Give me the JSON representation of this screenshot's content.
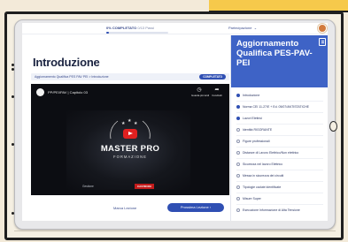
{
  "topbar": {
    "progress_label": "0% COMPLETATO",
    "progress_sub": "0/13 Passi",
    "progress_fraction": 0.0,
    "user_link": "Partecipazione"
  },
  "main": {
    "title": "Introduzione",
    "crumb": "Aggiornamento Qualifica PES PAV PEI > Introduzione",
    "badge": "COMPLETATO"
  },
  "video": {
    "title": "PP/PEI/PAV | Capitolo 03",
    "action_later": "Guarda più tardi",
    "action_share": "Condividi",
    "brand_main": "MASTER PRO",
    "brand_sub": "FORMAZIONE",
    "footer_logo": "Gestione",
    "footer_badge": "CASTRONI"
  },
  "nav": {
    "prev": "Marca Lezione",
    "next": "Prossima Lezione  ›"
  },
  "sidebar": {
    "title": "Aggiornamento Qualifica PES-PAV-PEI",
    "items": [
      {
        "label": "Introduzione",
        "state": "solid"
      },
      {
        "label": "Norma CEI 11-27/E + Ed. 05/07/ANTISTATICHE",
        "state": "solid"
      },
      {
        "label": "Lavori Elettrici",
        "state": "solid"
      },
      {
        "label": "Identità RIGORANTE",
        "state": "ring"
      },
      {
        "label": "Figure professionali",
        "state": "ring"
      },
      {
        "label": "Distanze di Lavoro Elettrico/Non elettrico",
        "state": "ring"
      },
      {
        "label": "Sicurezza nel lavoro Elettrico",
        "state": "ring"
      },
      {
        "label": "Messa in sicurezza dei circuiti",
        "state": "ring"
      },
      {
        "label": "Tipologie cadute identificate",
        "state": "ring"
      },
      {
        "label": "Misure Super",
        "state": "ring"
      },
      {
        "label": "Esecuzione Informazione di Alta Tensione",
        "state": "ring"
      }
    ]
  },
  "colors": {
    "accent": "#2f4fb3",
    "sidebar_head": "#3e63c6",
    "burst": "#f6c94b",
    "play_red": "#e02020"
  },
  "icons": [
    "play-icon",
    "clock-icon",
    "share-icon",
    "close-icon",
    "avatar"
  ]
}
